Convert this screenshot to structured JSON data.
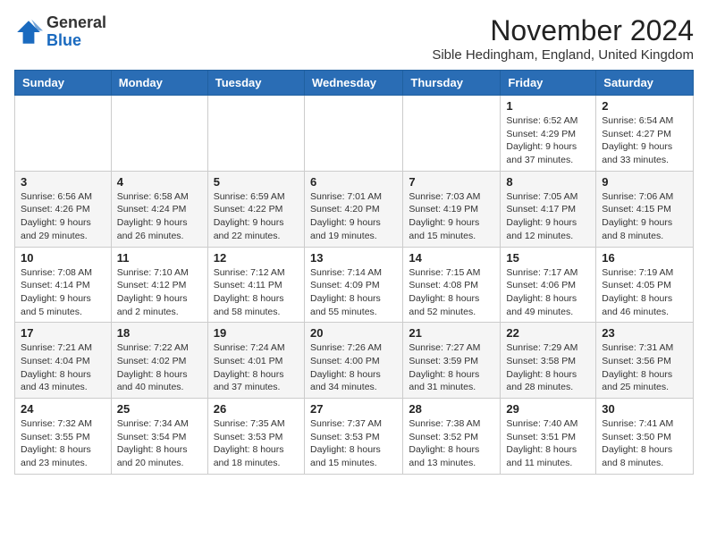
{
  "logo": {
    "general": "General",
    "blue": "Blue"
  },
  "title": "November 2024",
  "subtitle": "Sible Hedingham, England, United Kingdom",
  "days_header": [
    "Sunday",
    "Monday",
    "Tuesday",
    "Wednesday",
    "Thursday",
    "Friday",
    "Saturday"
  ],
  "weeks": [
    [
      {
        "day": "",
        "info": ""
      },
      {
        "day": "",
        "info": ""
      },
      {
        "day": "",
        "info": ""
      },
      {
        "day": "",
        "info": ""
      },
      {
        "day": "",
        "info": ""
      },
      {
        "day": "1",
        "info": "Sunrise: 6:52 AM\nSunset: 4:29 PM\nDaylight: 9 hours and 37 minutes."
      },
      {
        "day": "2",
        "info": "Sunrise: 6:54 AM\nSunset: 4:27 PM\nDaylight: 9 hours and 33 minutes."
      }
    ],
    [
      {
        "day": "3",
        "info": "Sunrise: 6:56 AM\nSunset: 4:26 PM\nDaylight: 9 hours and 29 minutes."
      },
      {
        "day": "4",
        "info": "Sunrise: 6:58 AM\nSunset: 4:24 PM\nDaylight: 9 hours and 26 minutes."
      },
      {
        "day": "5",
        "info": "Sunrise: 6:59 AM\nSunset: 4:22 PM\nDaylight: 9 hours and 22 minutes."
      },
      {
        "day": "6",
        "info": "Sunrise: 7:01 AM\nSunset: 4:20 PM\nDaylight: 9 hours and 19 minutes."
      },
      {
        "day": "7",
        "info": "Sunrise: 7:03 AM\nSunset: 4:19 PM\nDaylight: 9 hours and 15 minutes."
      },
      {
        "day": "8",
        "info": "Sunrise: 7:05 AM\nSunset: 4:17 PM\nDaylight: 9 hours and 12 minutes."
      },
      {
        "day": "9",
        "info": "Sunrise: 7:06 AM\nSunset: 4:15 PM\nDaylight: 9 hours and 8 minutes."
      }
    ],
    [
      {
        "day": "10",
        "info": "Sunrise: 7:08 AM\nSunset: 4:14 PM\nDaylight: 9 hours and 5 minutes."
      },
      {
        "day": "11",
        "info": "Sunrise: 7:10 AM\nSunset: 4:12 PM\nDaylight: 9 hours and 2 minutes."
      },
      {
        "day": "12",
        "info": "Sunrise: 7:12 AM\nSunset: 4:11 PM\nDaylight: 8 hours and 58 minutes."
      },
      {
        "day": "13",
        "info": "Sunrise: 7:14 AM\nSunset: 4:09 PM\nDaylight: 8 hours and 55 minutes."
      },
      {
        "day": "14",
        "info": "Sunrise: 7:15 AM\nSunset: 4:08 PM\nDaylight: 8 hours and 52 minutes."
      },
      {
        "day": "15",
        "info": "Sunrise: 7:17 AM\nSunset: 4:06 PM\nDaylight: 8 hours and 49 minutes."
      },
      {
        "day": "16",
        "info": "Sunrise: 7:19 AM\nSunset: 4:05 PM\nDaylight: 8 hours and 46 minutes."
      }
    ],
    [
      {
        "day": "17",
        "info": "Sunrise: 7:21 AM\nSunset: 4:04 PM\nDaylight: 8 hours and 43 minutes."
      },
      {
        "day": "18",
        "info": "Sunrise: 7:22 AM\nSunset: 4:02 PM\nDaylight: 8 hours and 40 minutes."
      },
      {
        "day": "19",
        "info": "Sunrise: 7:24 AM\nSunset: 4:01 PM\nDaylight: 8 hours and 37 minutes."
      },
      {
        "day": "20",
        "info": "Sunrise: 7:26 AM\nSunset: 4:00 PM\nDaylight: 8 hours and 34 minutes."
      },
      {
        "day": "21",
        "info": "Sunrise: 7:27 AM\nSunset: 3:59 PM\nDaylight: 8 hours and 31 minutes."
      },
      {
        "day": "22",
        "info": "Sunrise: 7:29 AM\nSunset: 3:58 PM\nDaylight: 8 hours and 28 minutes."
      },
      {
        "day": "23",
        "info": "Sunrise: 7:31 AM\nSunset: 3:56 PM\nDaylight: 8 hours and 25 minutes."
      }
    ],
    [
      {
        "day": "24",
        "info": "Sunrise: 7:32 AM\nSunset: 3:55 PM\nDaylight: 8 hours and 23 minutes."
      },
      {
        "day": "25",
        "info": "Sunrise: 7:34 AM\nSunset: 3:54 PM\nDaylight: 8 hours and 20 minutes."
      },
      {
        "day": "26",
        "info": "Sunrise: 7:35 AM\nSunset: 3:53 PM\nDaylight: 8 hours and 18 minutes."
      },
      {
        "day": "27",
        "info": "Sunrise: 7:37 AM\nSunset: 3:53 PM\nDaylight: 8 hours and 15 minutes."
      },
      {
        "day": "28",
        "info": "Sunrise: 7:38 AM\nSunset: 3:52 PM\nDaylight: 8 hours and 13 minutes."
      },
      {
        "day": "29",
        "info": "Sunrise: 7:40 AM\nSunset: 3:51 PM\nDaylight: 8 hours and 11 minutes."
      },
      {
        "day": "30",
        "info": "Sunrise: 7:41 AM\nSunset: 3:50 PM\nDaylight: 8 hours and 8 minutes."
      }
    ]
  ]
}
